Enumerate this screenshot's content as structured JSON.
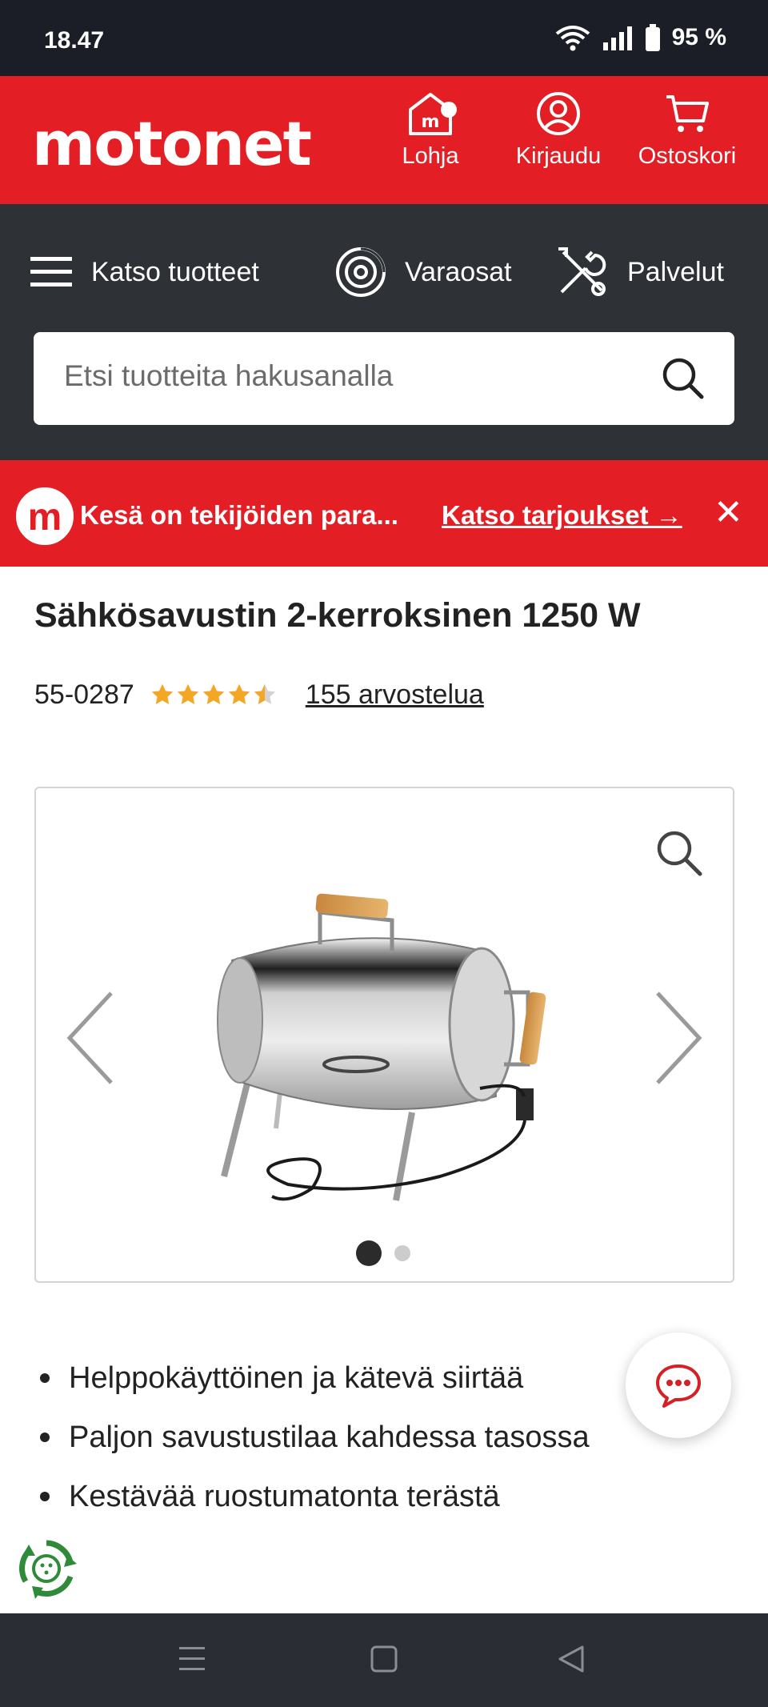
{
  "status_bar": {
    "time": "18.47",
    "battery": "95 %"
  },
  "header": {
    "logo": "motonet",
    "actions": [
      {
        "label": "Lohja",
        "icon": "store-icon"
      },
      {
        "label": "Kirjaudu",
        "icon": "user-icon"
      },
      {
        "label": "Ostoskori",
        "icon": "cart-icon"
      }
    ]
  },
  "nav": {
    "items": [
      {
        "label": "Katso tuotteet",
        "icon": "menu-icon"
      },
      {
        "label": "Varaosat",
        "icon": "brake-disc-icon"
      },
      {
        "label": "Palvelut",
        "icon": "tools-icon"
      }
    ],
    "search": {
      "placeholder": "Etsi tuotteita hakusanalla"
    }
  },
  "promo": {
    "text": "Kesä on tekijöiden para...",
    "link": "Katso tarjoukset →",
    "close": "✕"
  },
  "product": {
    "title": "Sähkösavustin 2-kerroksinen 1250 W",
    "sku": "55-0287",
    "rating": 4.5,
    "rating_max": 5,
    "reviews_label": "155 arvostelua",
    "gallery": {
      "current_slide": 1,
      "total_slides": 2
    },
    "features": [
      "Helppokäyttöinen ja kätevä siirtää",
      "Paljon savustustilaa kahdessa tasossa",
      "Kestävää ruostumatonta terästä"
    ]
  },
  "colors": {
    "brand_red": "#e31e24",
    "nav_dark": "#2e3136",
    "star": "#f5a623"
  }
}
